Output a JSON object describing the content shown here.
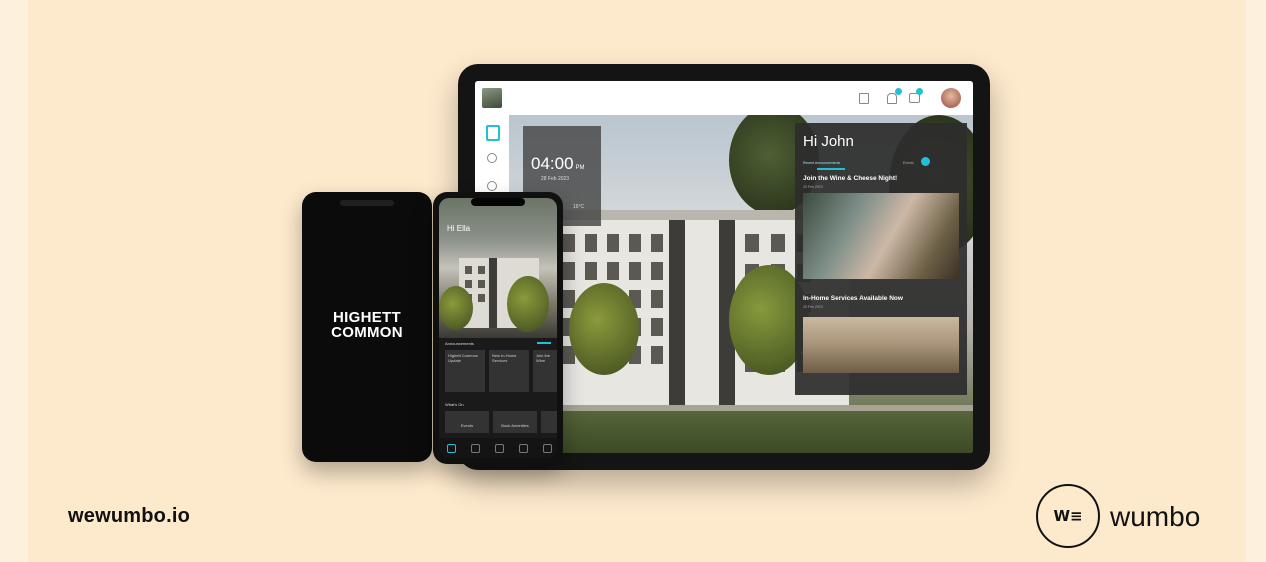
{
  "tablet": {
    "clock": {
      "time": "04:00",
      "ampm": "PM",
      "date": "28 Feb 2023",
      "weather": "16°C"
    },
    "card": {
      "greeting": "Hi John",
      "tabs": [
        "Recent Announcements",
        "Events"
      ],
      "items": [
        {
          "title": "Join the Wine & Cheese Night!",
          "date": "20 Feb 2023"
        },
        {
          "title": "In-Home Services Available Now",
          "date": "20 Feb 2023"
        }
      ]
    }
  },
  "phone_splash": {
    "brand_line1": "HIGHETT",
    "brand_line2": "COMMON"
  },
  "phone_app": {
    "greeting": "Hi Ella",
    "section_announcements": "Announcements",
    "tiles": [
      "Highett Common Update",
      "New In-Home Services",
      "Join the Wine"
    ],
    "section_whats_on": "What's On",
    "actions": [
      "Events",
      "Book Amenities",
      ""
    ]
  },
  "footer": {
    "website": "wewumbo.io",
    "brand_mark": "W≡",
    "brand_name": "wumbo"
  },
  "colors": {
    "background": "#fde9cc",
    "accent": "#21c0d6",
    "device": "#141414"
  }
}
